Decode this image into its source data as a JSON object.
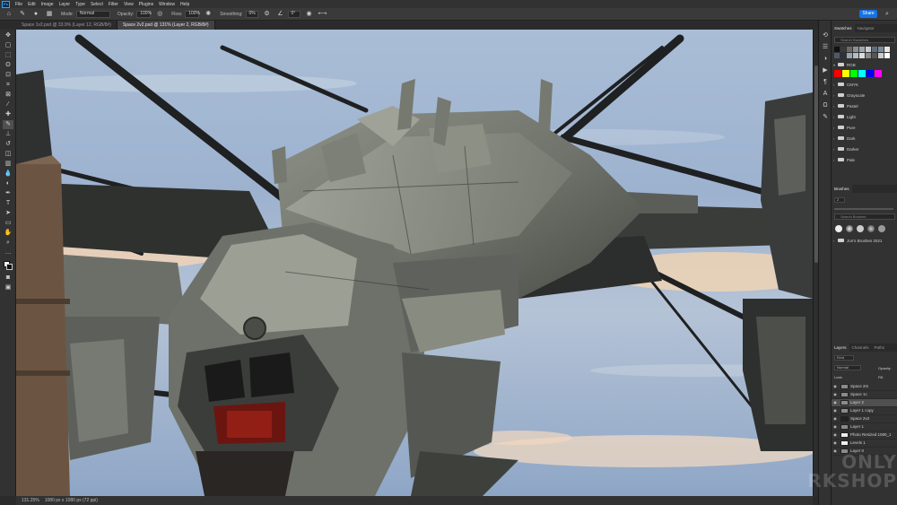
{
  "menubar": {
    "app_logo": "Ps",
    "items": [
      "File",
      "Edit",
      "Image",
      "Layer",
      "Type",
      "Select",
      "Filter",
      "View",
      "Plugins",
      "Window",
      "Help"
    ]
  },
  "options": {
    "mode_label": "Mode:",
    "mode_value": "Normal",
    "opacity_label": "Opacity:",
    "opacity_value": "100%",
    "flow_label": "Flow:",
    "flow_value": "100%",
    "smoothing_label": "Smoothing:",
    "smoothing_value": "0%",
    "angle_value": "0°",
    "share_label": "Share"
  },
  "tabs": [
    {
      "label": "Space 1v2.psd @ 33.9% (Layer 12, RGB/8#)",
      "active": false
    },
    {
      "label": "Space 2v2.psd @ 131% (Layer 2, RGB/8#)",
      "active": true
    }
  ],
  "status": {
    "zoom": "131.25%",
    "doc_size": "1080 px x 1080 px (72 ppi)"
  },
  "panels": {
    "swatches_tabs": [
      "Swatches",
      "Navigator"
    ],
    "swatches_search_placeholder": "Search Swatches",
    "swatch_groups": [
      "RGB",
      "CMYK",
      "Grayscale",
      "Pastel",
      "Light",
      "Pure",
      "Dark",
      "Darker",
      "Pale"
    ],
    "brushes_title": "Brushes",
    "brush_size": "2",
    "brush_search_placeholder": "Search Brushes",
    "brush_folder": "Jon's Brushes 2021",
    "layers_tabs": [
      "Layers",
      "Channels",
      "Paths"
    ],
    "layers_kind": "Kind",
    "blend_mode": "Normal",
    "opacity_label": "Opacity:",
    "lock_label": "Lock:",
    "fill_label": "Fill:",
    "layers": [
      {
        "name": "Space 2m",
        "selected": false,
        "thumb": "grey"
      },
      {
        "name": "Space 1c",
        "selected": false,
        "thumb": "grey"
      },
      {
        "name": "Layer 2",
        "selected": true,
        "thumb": "grey"
      },
      {
        "name": "Layer 1 copy",
        "selected": false,
        "thumb": "grey"
      },
      {
        "name": "Space 2v2",
        "selected": false,
        "thumb": "dark"
      },
      {
        "name": "Layer 1",
        "selected": false,
        "thumb": "grey"
      },
      {
        "name": "Photo Resized 1080_1",
        "selected": false,
        "thumb": "white"
      },
      {
        "name": "Levels 1",
        "selected": false,
        "thumb": "white"
      },
      {
        "name": "Layer 0",
        "selected": false,
        "thumb": "grey"
      }
    ]
  },
  "watermark": {
    "line1": "ONLY",
    "line2": "RKSHOP"
  },
  "colors": {
    "accent": "#1473e6",
    "panel_bg": "#323232",
    "sky_top": "#9bb3d2",
    "sky_glow": "#f2cfa8"
  }
}
